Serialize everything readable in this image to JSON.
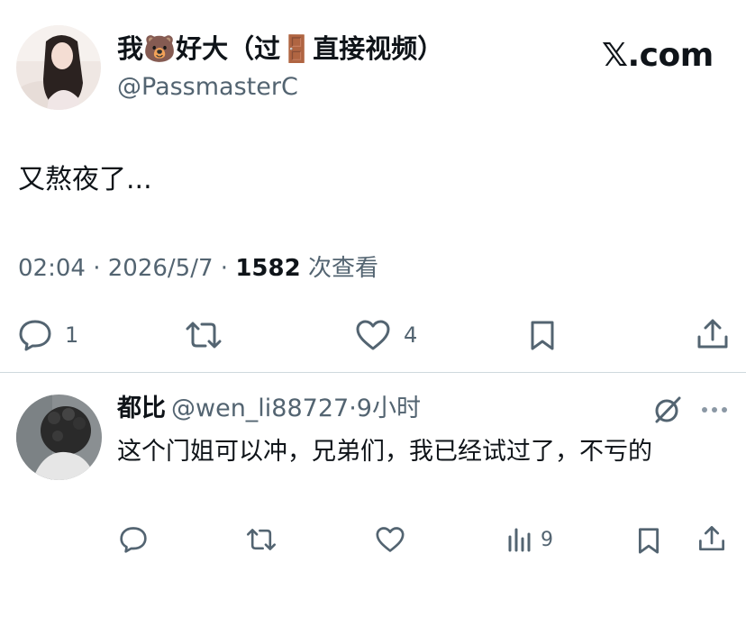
{
  "tweet": {
    "author_name": "我🐻好大（过🚪直接视频）",
    "author_handle": "@PassmasterC",
    "site_logo": "𝕏.com",
    "text": "又熬夜了...",
    "time": "02:04",
    "date": "2026/5/7",
    "views_count": "1582",
    "views_label": "次查看",
    "separator": "·",
    "actions": {
      "reply_count": "1",
      "like_count": "4"
    }
  },
  "reply": {
    "author_name": "都比",
    "author_handle": "@wen_li88727",
    "separator": "·",
    "time_ago": "9小时",
    "text": "这个门姐可以冲，兄弟们，我已经试过了，不亏的",
    "actions": {
      "views_count": "9"
    }
  },
  "colors": {
    "text_primary": "#0f1419",
    "text_secondary": "#536471",
    "divider": "#cfd9de"
  },
  "icons": [
    "reply-icon",
    "retweet-icon",
    "like-icon",
    "bookmark-icon",
    "share-icon",
    "views-icon",
    "grok-icon",
    "more-icon"
  ]
}
